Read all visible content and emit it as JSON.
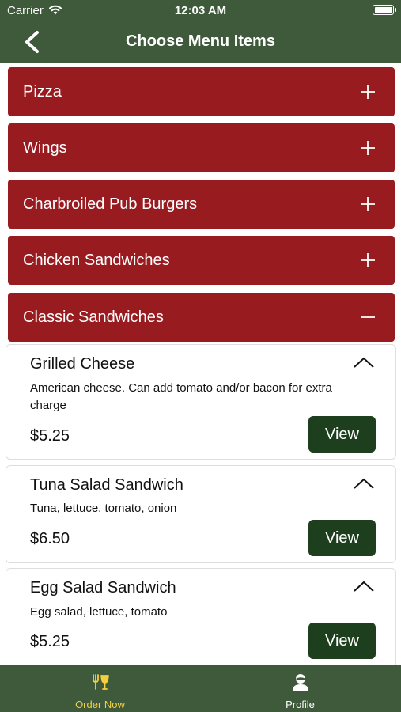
{
  "status_bar": {
    "carrier": "Carrier",
    "time": "12:03 AM"
  },
  "nav": {
    "title": "Choose Menu Items",
    "back_icon": "chevron-left-icon"
  },
  "categories": [
    {
      "label": "Pizza",
      "expanded": false
    },
    {
      "label": "Wings",
      "expanded": false
    },
    {
      "label": "Charbroiled Pub Burgers",
      "expanded": false
    },
    {
      "label": "Chicken Sandwiches",
      "expanded": false
    },
    {
      "label": "Classic Sandwiches",
      "expanded": true
    }
  ],
  "items": [
    {
      "name": "Grilled Cheese",
      "description": "American cheese. Can add tomato and/or bacon for extra charge",
      "price": "$5.25",
      "button": "View"
    },
    {
      "name": "Tuna Salad Sandwich",
      "description": "Tuna, lettuce, tomato, onion",
      "price": "$6.50",
      "button": "View"
    },
    {
      "name": "Egg Salad Sandwich",
      "description": "Egg salad, lettuce, tomato",
      "price": "$5.25",
      "button": "View"
    }
  ],
  "tabs": [
    {
      "label": "Order Now",
      "icon": "utensils-icon",
      "active": true
    },
    {
      "label": "Profile",
      "icon": "person-icon",
      "active": false
    }
  ],
  "colors": {
    "header": "#3e5a3a",
    "category": "#981b20",
    "view_button": "#1e3f1e",
    "tab_active": "#f4d03f",
    "tab_inactive": "#ffffff"
  }
}
